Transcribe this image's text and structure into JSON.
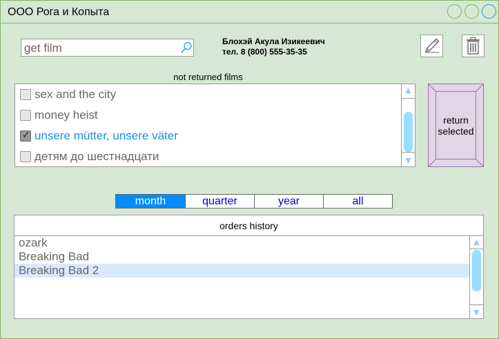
{
  "window": {
    "title": "ООО Рога и Копыта"
  },
  "search": {
    "value": "get film",
    "placeholder": ""
  },
  "user": {
    "name": "Блохэй Акула Изикеевич",
    "phone": "тел. 8 (800) 555-35-35"
  },
  "not_returned": {
    "label": "not returned films",
    "items": [
      {
        "label": "sex and the city",
        "checked": false
      },
      {
        "label": "money heist",
        "checked": false
      },
      {
        "label": "unsere mütter, unsere väter",
        "checked": true
      },
      {
        "label": "детям до шестнадцати",
        "checked": false
      }
    ],
    "scroll": {
      "up": "▲",
      "down": "▼"
    }
  },
  "return_button": {
    "line1": "return",
    "line2": "selected"
  },
  "period_tabs": {
    "items": [
      "month",
      "quarter",
      "year",
      "all"
    ],
    "active": "month"
  },
  "history": {
    "label": "orders history",
    "items": [
      "ozark",
      "Breaking Bad",
      "Breaking Bad 2"
    ],
    "highlighted_index": 2,
    "scroll": {
      "up": "▲",
      "down": "▼"
    }
  },
  "colors": {
    "window_bg": "#d5e8d4",
    "window_border": "#82b366",
    "accent": "#008cff",
    "selected_text": "#1c8ee6",
    "return_bg": "#e1d5e7",
    "return_border": "#9673a6",
    "highlight_row": "#dae8fc"
  },
  "icons": {
    "search": "search-icon",
    "edit": "pencil-icon",
    "delete": "trash-icon",
    "window_buttons": [
      "minimize-icon",
      "maximize-icon",
      "close-icon"
    ]
  }
}
